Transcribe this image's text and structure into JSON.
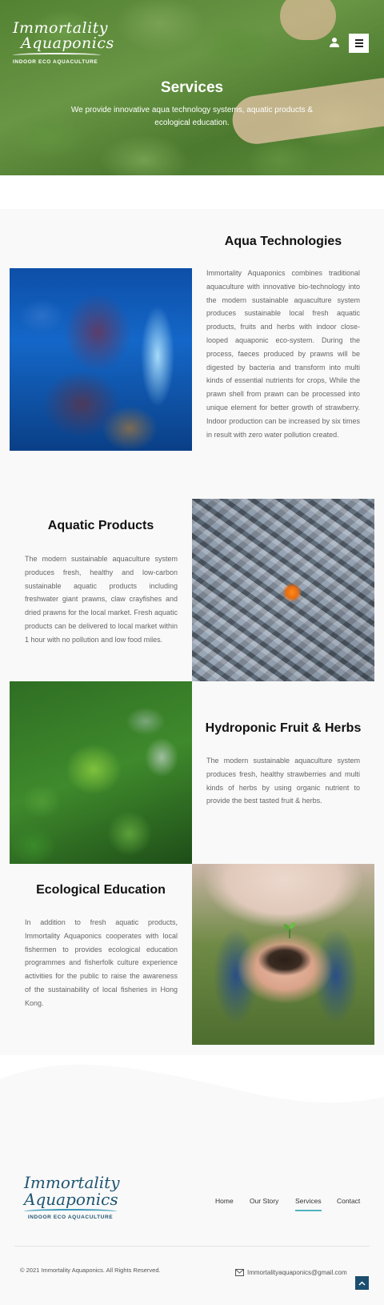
{
  "header": {
    "logo_line1": "Immortality",
    "logo_line2": "Aquaponics",
    "logo_sub": "INDOOR ECO AQUACULTURE"
  },
  "hero": {
    "title": "Services",
    "subtitle": "We provide innovative aqua technology systems, aquatic products & ecological education."
  },
  "services": [
    {
      "title": "Aqua Technologies",
      "text": "Immortality Aquaponics combines traditional aquaculture with innovative bio-technology into the modern sustainable aquaculture system produces sustainable local fresh aquatic products, fruits and herbs with indoor close-looped aquaponic eco-system. During the process, faeces produced by prawns will be digested by bacteria and transform into multi kinds of essential nutrients for crops, While the prawn shell from prawn can be processed into unique element for better growth of strawberry. Indoor production can be increased by six times in result with zero water pollution created."
    },
    {
      "title": "Aquatic Products",
      "text": "The modern sustainable aquaculture system produces fresh, healthy and low-carbon sustainable aquatic products including freshwater giant prawns, claw crayfishes and dried prawns for the local market. Fresh aquatic products can be delivered to local market within 1 hour with no pollution and low food miles."
    },
    {
      "title": "Hydroponic Fruit & Herbs",
      "text": "The modern sustainable aquaculture system produces fresh, healthy strawberries and multi kinds of herbs by using organic nutrient to provide the best tasted fruit & herbs."
    },
    {
      "title": "Ecological Education",
      "text": "In addition to fresh aquatic products, Immortality Aquaponics cooperates with local fishermen to provides ecological education programmes and fisherfolk culture experience activities for the public to raise the awareness of the sustainability of local fisheries in Hong Kong."
    }
  ],
  "footer": {
    "logo_line1": "Immortality",
    "logo_line2": "Aquaponics",
    "logo_sub": "INDOOR ECO AQUACULTURE",
    "nav": [
      "Home",
      "Our Story",
      "Services",
      "Contact"
    ],
    "active_nav": "Services",
    "copyright": "© 2021 Immortality Aquaponics. All Rights Reserved.",
    "email": "Immortalityaquaponics@gmail.com"
  },
  "colors": {
    "accent": "#52b3c0",
    "brand_dark": "#1c4e6f"
  },
  "icons": [
    "user-icon",
    "menu-icon",
    "mail-icon",
    "chevron-up-icon"
  ]
}
